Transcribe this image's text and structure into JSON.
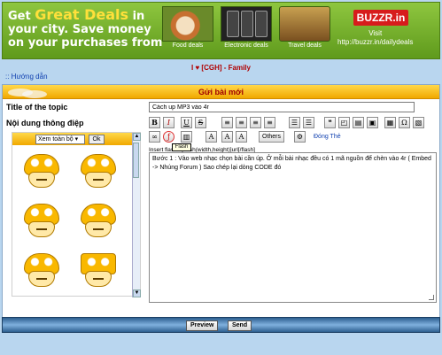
{
  "banner": {
    "line1": "Get",
    "highlight": "Great Deals",
    "line1_end": "in",
    "line2": "your city. Save money",
    "line3": "on your purchases from",
    "deals": [
      "Food deals",
      "Electronic deals",
      "Travel deals"
    ],
    "brand": "BUZZR.in",
    "visit_label": "Visit",
    "visit_url": "http://buzzr.in/dailydeals"
  },
  "page": {
    "topic_title": "I ♥ [CGH] - Family",
    "help_link": ":: Hướng dẫn"
  },
  "form": {
    "header": "Gửi bài mới",
    "title_label": "Title of the topic",
    "title_value": "Cách up MP3 vào 4r",
    "content_label": "Nội dung thông điệp",
    "emoticon_select": "Xem toàn bộ",
    "emoticon_ok": "Ok",
    "toolbar": {
      "bold": "B",
      "italic": "I",
      "underline": "U",
      "strike": "S",
      "others": "Others",
      "close_tags": "Đóng Thẻ"
    },
    "tooltip": "Flash",
    "insert_hint": "Insert flash : [flash(width,height)]url[/flash]",
    "editor_text": "Bước 1 : Vào web nhạc chọn bài cần úp. Ở mỗi bài nhạc đều có 1 mã nguồn để chèn vào 4r ( Embed -> Nhúng Forum ) Sao chép lại dòng CODE đó",
    "preview_button": "Preview",
    "send_button": "Send"
  }
}
